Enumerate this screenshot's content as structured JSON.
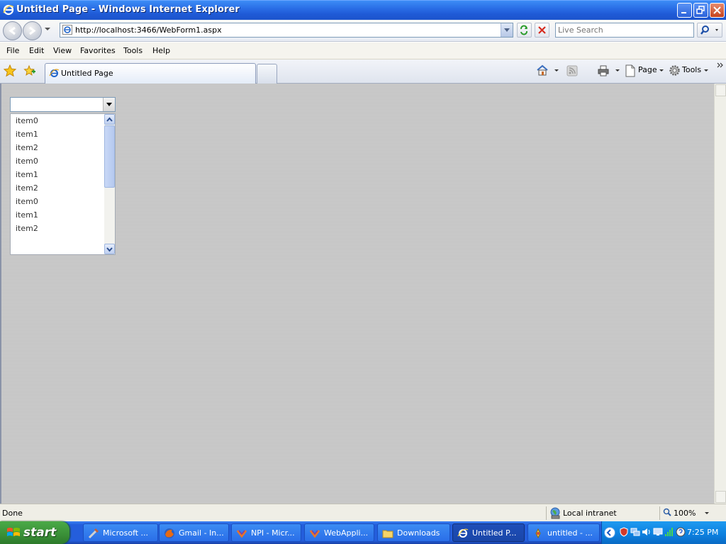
{
  "window": {
    "title": "Untitled Page - Windows Internet Explorer"
  },
  "address": {
    "url": "http://localhost:3466/WebForm1.aspx",
    "search_placeholder": "Live Search"
  },
  "menu": {
    "items": [
      "File",
      "Edit",
      "View",
      "Favorites",
      "Tools",
      "Help"
    ]
  },
  "tabs": {
    "active_label": "Untitled Page"
  },
  "commandbar": {
    "page_label": "Page",
    "tools_label": "Tools"
  },
  "page": {
    "combo_value": "",
    "list_items": [
      "item0",
      "item1",
      "item2",
      "item0",
      "item1",
      "item2",
      "item0",
      "item1",
      "item2"
    ]
  },
  "status": {
    "text": "Done",
    "zone": "Local intranet",
    "zoom": "100%"
  },
  "taskbar": {
    "start_label": "start",
    "tasks": [
      {
        "label": "Microsoft ..."
      },
      {
        "label": "Gmail - In..."
      },
      {
        "label": "NPI - Micr..."
      },
      {
        "label": "WebAppli..."
      },
      {
        "label": "Downloads"
      },
      {
        "label": "Untitled P..."
      },
      {
        "label": "untitled - ..."
      }
    ],
    "clock": "7:25 PM"
  },
  "colors": {
    "titlebar": "#2a6ee6",
    "taskbar": "#245edc",
    "start": "#3a8f37",
    "content_bg": "#c8c8c8"
  }
}
